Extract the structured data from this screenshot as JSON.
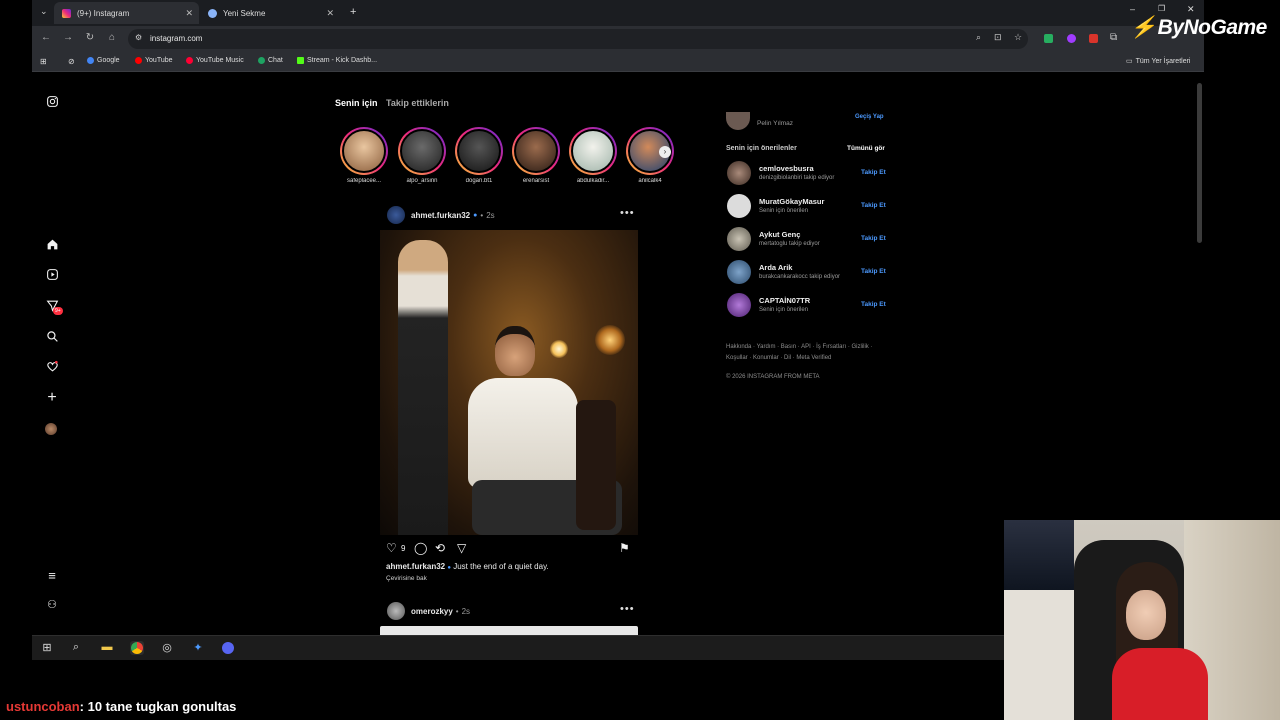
{
  "browser": {
    "tabs": [
      {
        "label": "(9+) Instagram",
        "active": true
      },
      {
        "label": "Yeni Sekme",
        "active": false
      }
    ],
    "new_tab_label": "+",
    "url": "instagram.com",
    "bookmarks": [
      "Google",
      "YouTube",
      "YouTube Music",
      "Chat",
      "Stream - Kick Dashb..."
    ],
    "all_bookmarks_label": "Tüm Yer İşaretleri"
  },
  "overlay": {
    "brand": "ByNoGame",
    "chat_user": "ustuncoban",
    "chat_message": ": 10 tane tugkan gonultas"
  },
  "instagram": {
    "sidebar": {
      "notifications_badge": "9+"
    },
    "feed_tabs": [
      "Senin için",
      "Takip ettiklerin"
    ],
    "stories": [
      "safeplacee...",
      "alpo_arsinn",
      "dogan.bt1",
      "erenarsist",
      "abdulkadir...",
      "anilcalk4"
    ],
    "post": {
      "username": "ahmet.furkan32",
      "time": "2s",
      "likes": "9",
      "caption_user": "ahmet.furkan32",
      "caption_text": "Just the end of a quiet day.",
      "translate_label": "Çevirisine bak"
    },
    "next_post": {
      "username": "omerozkyy",
      "time": "2s"
    },
    "right": {
      "account_name": "Pelin Yılmaz",
      "switch_label": "Geçiş Yap",
      "suggestions_title": "Senin için önerilenler",
      "see_all": "Tümünü gör",
      "follow_label": "Takip Et",
      "suggestions": [
        {
          "name": "cemlovesbusra",
          "sub": "denizgibiolanbiri takip ediyor"
        },
        {
          "name": "MuratGökayMasur",
          "sub": "Senin için önerilen"
        },
        {
          "name": "Aykut Genç",
          "sub": "mertatoglu takip ediyor"
        },
        {
          "name": "Arda Arik",
          "sub": "burakcankarakocc takip ediyor"
        },
        {
          "name": "CAPTAİN07TR",
          "sub": "Senin için önerilen"
        }
      ],
      "footer_links": "Hakkında · Yardım · Basın · API · İş Fırsatları · Gizlilik · Koşullar · Konumlar · Dil · Meta Verified",
      "copyright": "© 2026 INSTAGRAM FROM META"
    }
  },
  "colors": {
    "accent_blue": "#4c9aff",
    "brand_red": "#e53935",
    "story_ring": "#ee2a7b"
  }
}
